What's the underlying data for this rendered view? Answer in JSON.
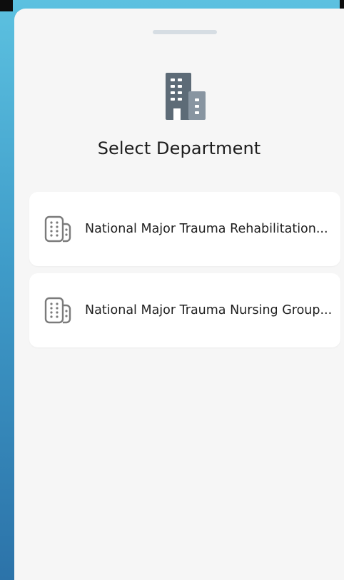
{
  "sheet": {
    "title": "Select Department",
    "icon": "office-building-icon"
  },
  "departments": [
    {
      "label": "National Major Trauma Rehabilitation...",
      "icon": "building-outline-icon"
    },
    {
      "label": "National Major Trauma Nursing Group...",
      "icon": "building-outline-icon"
    }
  ],
  "colors": {
    "background_top": "#5cc1e0",
    "background_bottom": "#2c73a9",
    "sheet": "#f6f6f6",
    "card": "#ffffff",
    "icon_dark": "#5d6b77",
    "icon_light": "#8a97a3",
    "text": "#1c1c1c"
  }
}
